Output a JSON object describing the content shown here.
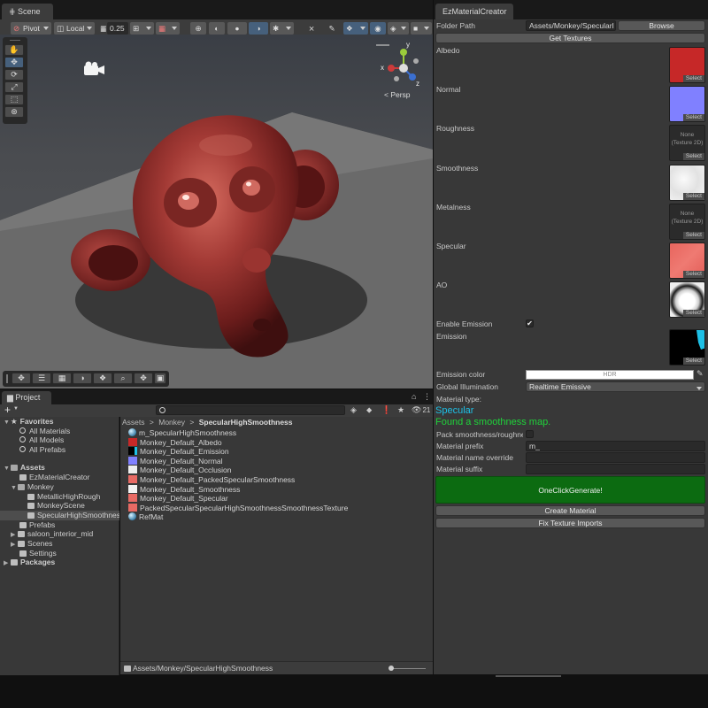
{
  "scene": {
    "tab": "Scene",
    "toolbar": {
      "pivot": "Pivot",
      "local": "Local",
      "snap_value": "0.25",
      "persp_label": "< Persp"
    },
    "gizmo_axes": {
      "x": "x",
      "y": "y",
      "z": "z"
    }
  },
  "project": {
    "tab": "Project",
    "add_label": "+",
    "hidden_count": "21",
    "favorites": {
      "header": "Favorites",
      "items": [
        "All Materials",
        "All Models",
        "All Prefabs"
      ]
    },
    "assets": {
      "header": "Assets",
      "items": [
        "EzMaterialCreator",
        "Monkey",
        "MetallicHighRough",
        "MonkeyScene",
        "SpecularHighSmoothness",
        "Prefabs",
        "saloon_interior_mid",
        "Scenes",
        "Settings"
      ]
    },
    "packages": "Packages",
    "breadcrumb": [
      "Assets",
      "Monkey",
      "SpecularHighSmoothness"
    ],
    "files": [
      {
        "name": "m_SpecularHighSmoothness",
        "color": "sphere"
      },
      {
        "name": "Monkey_Default_Albedo",
        "color": "#c62828"
      },
      {
        "name": "Monkey_Default_Emission",
        "color": "#000000"
      },
      {
        "name": "Monkey_Default_Normal",
        "color": "#8080ff"
      },
      {
        "name": "Monkey_Default_Occlusion",
        "color": "#eeeeee"
      },
      {
        "name": "Monkey_Default_PackedSpecularSmoothness",
        "color": "#e86a64"
      },
      {
        "name": "Monkey_Default_Smoothness",
        "color": "#f2f2f2"
      },
      {
        "name": "Monkey_Default_Specular",
        "color": "#e86a64"
      },
      {
        "name": "PackedSpecularSpecularHighSmoothnessSmoothnessTexture",
        "color": "#e86a64"
      },
      {
        "name": "RefMat",
        "color": "sphere"
      }
    ],
    "status_path": "Assets/Monkey/SpecularHighSmoothness"
  },
  "creator": {
    "tab": "EzMaterialCreator",
    "folder_path_label": "Folder Path",
    "folder_path_value": "Assets/Monkey/SpecularI",
    "browse": "Browse",
    "get_textures": "Get Textures",
    "slots": [
      {
        "label": "Albedo",
        "kind": "albedo"
      },
      {
        "label": "Normal",
        "kind": "normal"
      },
      {
        "label": "Roughness",
        "kind": "none"
      },
      {
        "label": "Smoothness",
        "kind": "smooth"
      },
      {
        "label": "Metalness",
        "kind": "none"
      },
      {
        "label": "Specular",
        "kind": "spec"
      },
      {
        "label": "AO",
        "kind": "ao"
      }
    ],
    "select_label": "Select",
    "none_line1": "None",
    "none_line2": "(Texture 2D)",
    "enable_emission_label": "Enable Emission",
    "emission_label": "Emission",
    "emission_color_label": "Emission color",
    "hdr": "HDR",
    "gi_label": "Global Illumination",
    "gi_value": "Realtime Emissive",
    "material_type_label": "Material type:",
    "material_type_value": "Specular",
    "found_msg": "Found a smoothness map.",
    "pack_label": "Pack smoothness/roughne",
    "prefix_label": "Material prefix",
    "prefix_value": "m_",
    "name_override_label": "Material name override",
    "suffix_label": "Material suffix",
    "one_click": "OneClickGenerate!",
    "create_material": "Create Material",
    "fix_imports": "Fix Texture Imports"
  },
  "colors": {
    "accent_blue": "#46607c",
    "generate_green": "#0c6b11",
    "specular_cyan": "#1ec0e6",
    "found_green": "#1fd33a",
    "albedo_red": "#c62828",
    "normal_blue": "#8080ff",
    "spec_pink": "#e86a64"
  }
}
